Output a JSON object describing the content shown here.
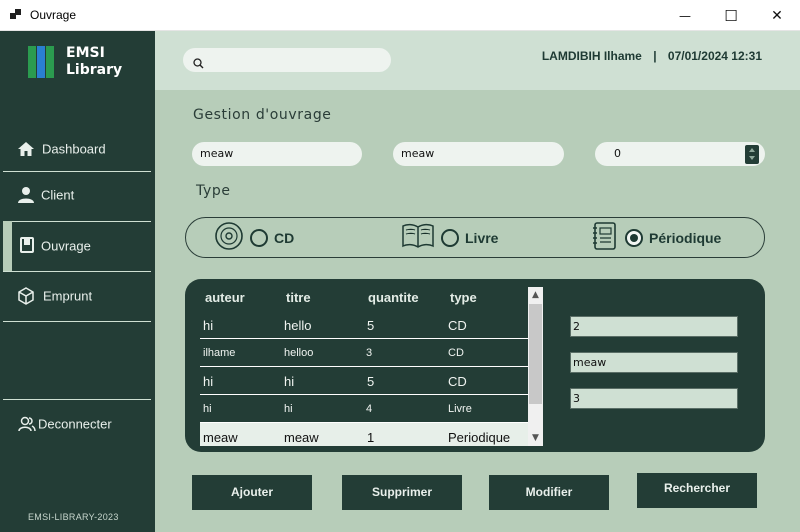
{
  "window": {
    "title": "Ouvrage",
    "minimize_glyph": "—",
    "maximize_glyph": "☐",
    "close_glyph": "✕"
  },
  "logo": {
    "line1": "EMSI",
    "line2": "Library",
    "colors": [
      "#2b9b4f",
      "#2a7fd1",
      "#2b9b4f"
    ]
  },
  "sidebar": {
    "items": [
      {
        "label": "Dashboard",
        "icon": "home-icon"
      },
      {
        "label": "Client",
        "icon": "user-icon"
      },
      {
        "label": "Ouvrage",
        "icon": "book-icon",
        "active": true
      },
      {
        "label": "Emprunt",
        "icon": "box-icon"
      }
    ],
    "logout": {
      "label": "Deconnecter",
      "icon": "users-icon"
    },
    "footer": "EMSI-LIBRARY-2023"
  },
  "header": {
    "search": {
      "value": "",
      "placeholder": ""
    },
    "user": "LAMDIBIH Ilhame",
    "separator": "|",
    "datetime": "07/01/2024 12:31"
  },
  "form": {
    "section_title": "Gestion d'ouvrage",
    "field1": "meaw",
    "field2": "meaw",
    "quantity": "0",
    "type_heading": "Type",
    "type_options": [
      {
        "label": "CD",
        "icon": "cd-icon",
        "checked": false
      },
      {
        "label": "Livre",
        "icon": "open-book-icon",
        "checked": false
      },
      {
        "label": "Périodique",
        "icon": "notebook-icon",
        "checked": true
      }
    ]
  },
  "table": {
    "columns": [
      "auteur",
      "titre",
      "quantite",
      "type"
    ],
    "rows": [
      {
        "auteur": "hi",
        "titre": "hello",
        "quantite": "5",
        "type": "CD",
        "size": "l"
      },
      {
        "auteur": "ilhame",
        "titre": "helloo",
        "quantite": "3",
        "type": "CD",
        "size": "s"
      },
      {
        "auteur": "hi",
        "titre": "hi",
        "quantite": "5",
        "type": "CD",
        "size": "l"
      },
      {
        "auteur": "hi",
        "titre": "hi",
        "quantite": "4",
        "type": "Livre",
        "size": "s"
      },
      {
        "auteur": "meaw",
        "titre": "meaw",
        "quantite": "1",
        "type": "Periodique",
        "size": "l",
        "selected": true
      }
    ]
  },
  "detail": {
    "field1": "2",
    "field2": "meaw",
    "field3": "3"
  },
  "actions": {
    "add": "Ajouter",
    "delete": "Supprimer",
    "edit": "Modifier",
    "search": "Rechercher"
  },
  "colors": {
    "sidebar": "#233d36",
    "background": "#b7cdb9",
    "topbar": "#cfe0d3",
    "input": "#eef3ef"
  }
}
